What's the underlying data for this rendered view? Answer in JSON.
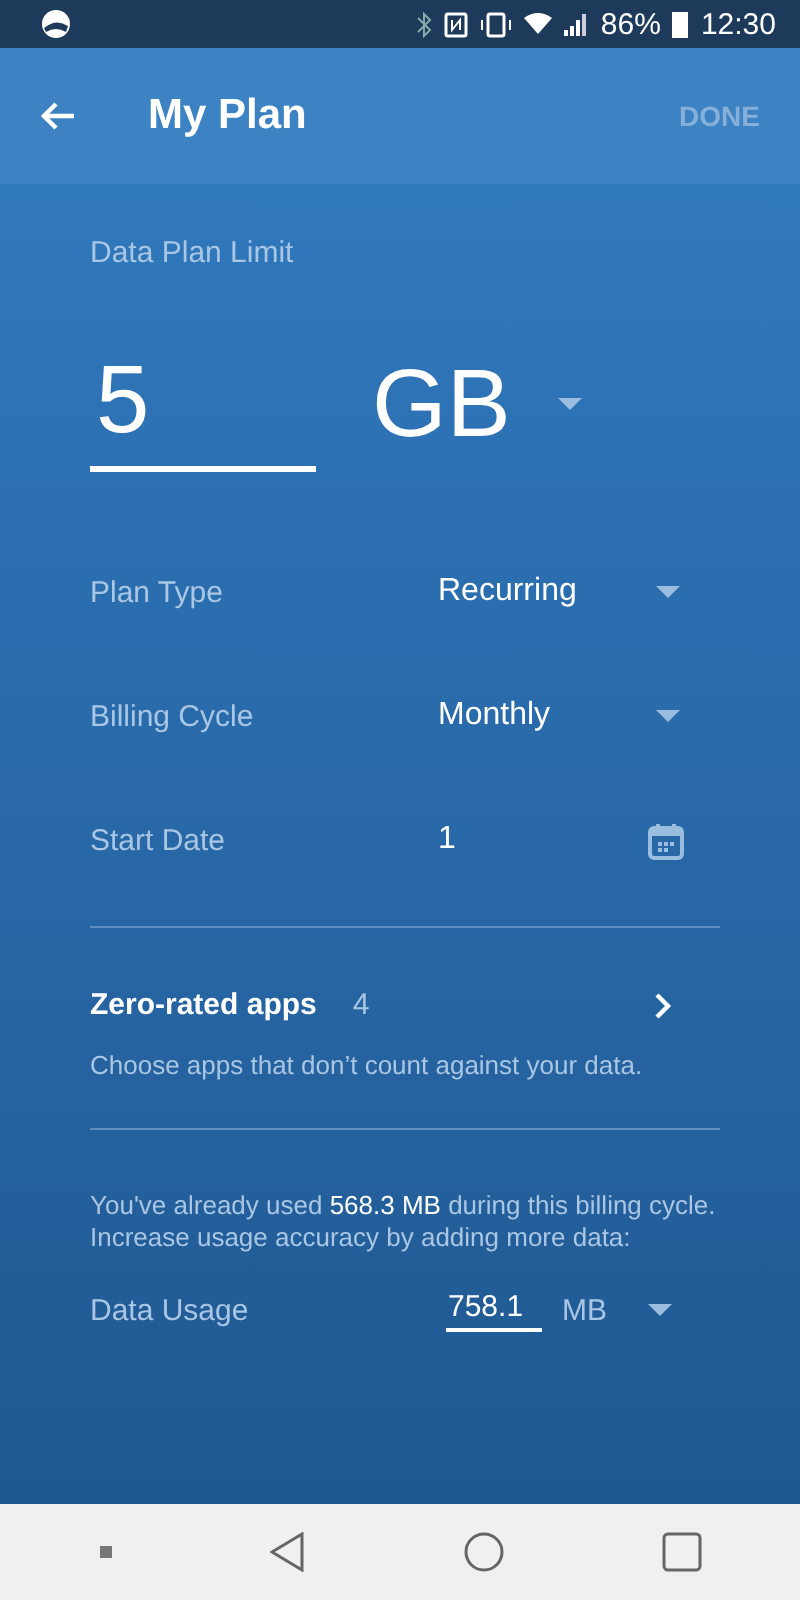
{
  "status_bar": {
    "battery": "86%",
    "time": "12:30"
  },
  "app_bar": {
    "title": "My Plan",
    "action": {
      "label": "DONE",
      "disabled": true
    }
  },
  "limit": {
    "label": "Data Plan Limit",
    "value": "5",
    "unit": "GB"
  },
  "settings": [
    {
      "kind": "dropdown",
      "label": "Plan Type",
      "value": "Recurring"
    },
    {
      "kind": "dropdown",
      "label": "Billing Cycle",
      "value": "Monthly"
    },
    {
      "kind": "date",
      "label": "Start Date",
      "value": "1"
    }
  ],
  "zero_rated": {
    "title": "Zero-rated apps",
    "count": "4",
    "description": "Choose apps that don’t count against your data."
  },
  "usage_note": "You've already used **568.3 MB** during this billing cycle. Increase usage accuracy by adding more data:",
  "data_usage": {
    "label": "Data Usage",
    "value": "758.1",
    "unit": "MB"
  }
}
